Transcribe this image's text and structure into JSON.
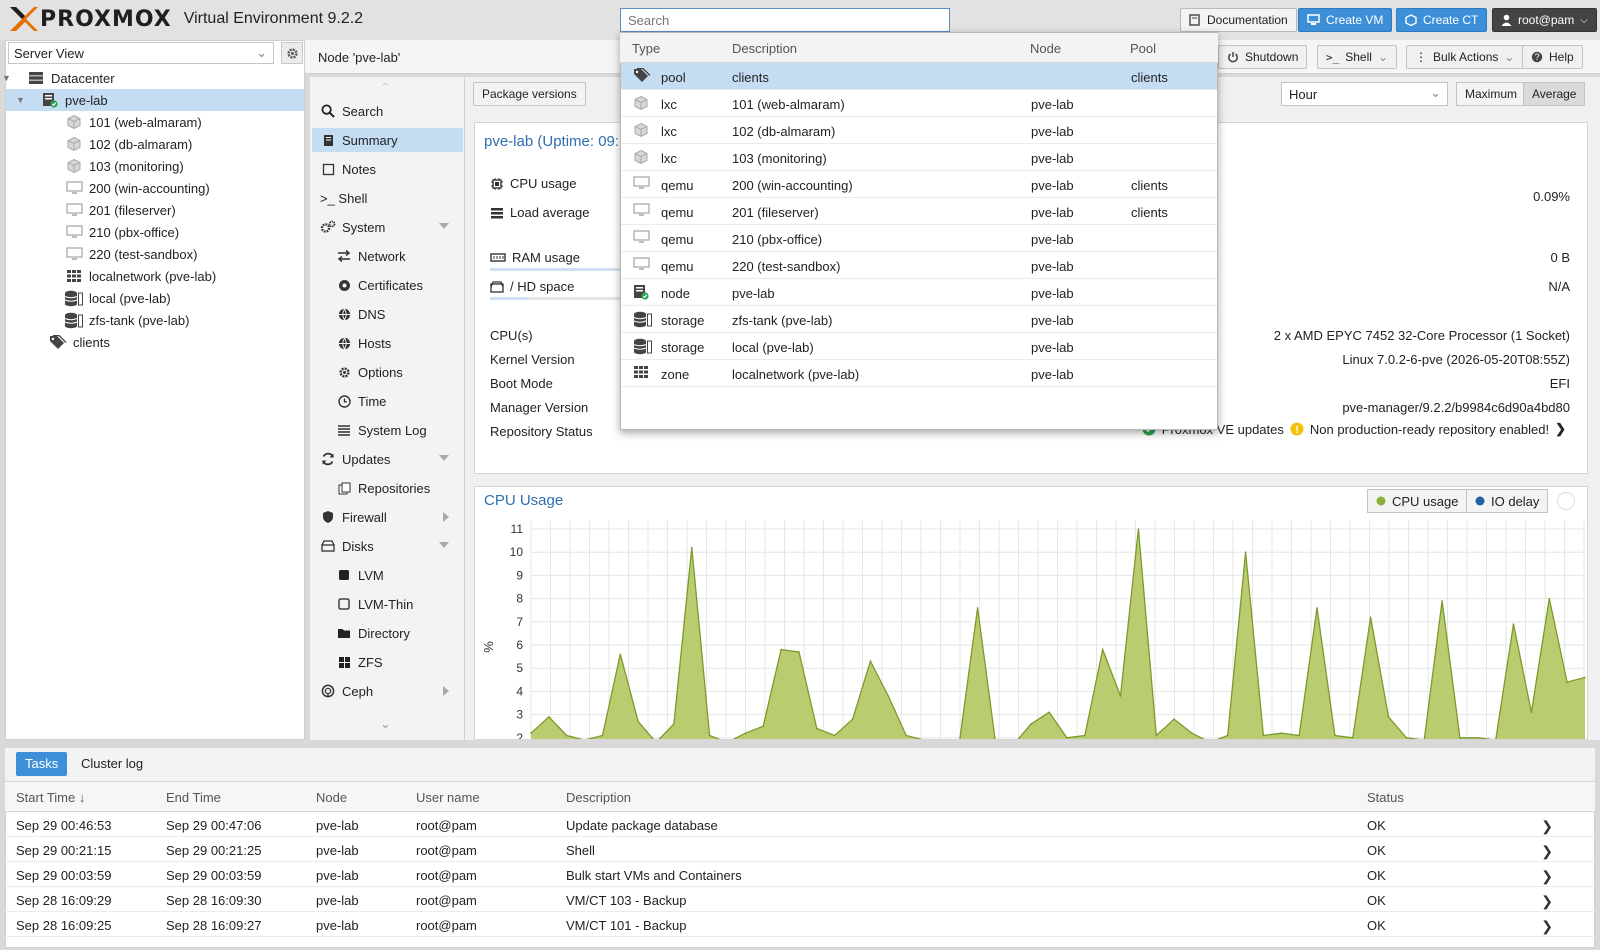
{
  "header": {
    "brand": "PROXMOX",
    "product": "Virtual Environment 9.2.2",
    "search_placeholder": "Search",
    "documentation_label": "Documentation",
    "create_vm_label": "Create VM",
    "create_ct_label": "Create CT",
    "user_label": "root@pam"
  },
  "tree": {
    "view": "Server View",
    "items": [
      {
        "label": "Datacenter",
        "icon": "datacenter-icon"
      },
      {
        "label": "pve-lab",
        "icon": "node-icon"
      },
      {
        "label": "101 (web-almaram)",
        "icon": "container-icon"
      },
      {
        "label": "102 (db-almaram)",
        "icon": "container-icon"
      },
      {
        "label": "103 (monitoring)",
        "icon": "container-icon"
      },
      {
        "label": "200 (win-accounting)",
        "icon": "vm-icon"
      },
      {
        "label": "201 (fileserver)",
        "icon": "vm-icon"
      },
      {
        "label": "210 (pbx-office)",
        "icon": "vm-icon"
      },
      {
        "label": "220 (test-sandbox)",
        "icon": "vm-icon"
      },
      {
        "label": "localnetwork (pve-lab)",
        "icon": "zone-icon"
      },
      {
        "label": "local (pve-lab)",
        "icon": "storage-icon"
      },
      {
        "label": "zfs-tank (pve-lab)",
        "icon": "storage-icon"
      },
      {
        "label": "clients",
        "icon": "pool-icon"
      }
    ]
  },
  "content": {
    "node_title": "Node 'pve-lab'",
    "shutdown_label": "Shutdown",
    "shell_label": "Shell",
    "bulk_actions_label": "Bulk Actions",
    "help_label": "Help",
    "package_versions_label": "Package versions",
    "timeframe": "Hour",
    "maximum_label": "Maximum",
    "average_label": "Average"
  },
  "submenu": {
    "items": [
      {
        "label": "Search",
        "icon": "search-icon"
      },
      {
        "label": "Summary",
        "icon": "book-icon"
      },
      {
        "label": "Notes",
        "icon": "note-icon"
      },
      {
        "label": ">_ Shell",
        "icon": ""
      },
      {
        "label": "System",
        "icon": "gears-icon"
      },
      {
        "label": "Network",
        "icon": "network-icon"
      },
      {
        "label": "Certificates",
        "icon": "certificate-icon"
      },
      {
        "label": "DNS",
        "icon": "globe-icon"
      },
      {
        "label": "Hosts",
        "icon": "globe-icon"
      },
      {
        "label": "Options",
        "icon": "gear-icon"
      },
      {
        "label": "Time",
        "icon": "clock-icon"
      },
      {
        "label": "System Log",
        "icon": "list-icon"
      },
      {
        "label": "Updates",
        "icon": "refresh-icon"
      },
      {
        "label": "Repositories",
        "icon": "files-icon"
      },
      {
        "label": "Firewall",
        "icon": "shield-icon"
      },
      {
        "label": "Disks",
        "icon": "hdd-icon"
      },
      {
        "label": "LVM",
        "icon": "square-icon"
      },
      {
        "label": "LVM-Thin",
        "icon": "square-outline-icon"
      },
      {
        "label": "Directory",
        "icon": "folder-icon"
      },
      {
        "label": "ZFS",
        "icon": "grid-icon"
      },
      {
        "label": "Ceph",
        "icon": "ceph-icon"
      }
    ]
  },
  "status": {
    "title": "pve-lab (Uptime: 09:",
    "cpu_label": "CPU usage",
    "cpu_value": "0.09%",
    "load_label": "Load average",
    "ram_label": "RAM usage",
    "ram_value": "0 B",
    "hd_label": "/ HD space",
    "hd_value": "N/A",
    "rows": [
      {
        "label": "CPU(s)",
        "value": "2 x AMD EPYC 7452 32-Core Processor (1 Socket)"
      },
      {
        "label": "Kernel Version",
        "value": "Linux 7.0.2-6-pve (2026-05-20T08:55Z)"
      },
      {
        "label": "Boot Mode",
        "value": "EFI"
      },
      {
        "label": "Manager Version",
        "value": "pve-manager/9.2.2/b9984c6d90a4bd80"
      },
      {
        "label": "Repository Status",
        "value": ""
      }
    ],
    "repo_updates": "Proxmox VE updates",
    "repo_warning": "Non production-ready repository enabled!",
    "colors": {
      "ok": "#2da44e",
      "warn": "#f4c20d"
    }
  },
  "chart_panel": {
    "title": "CPU Usage",
    "legend": [
      {
        "label": "CPU usage",
        "color": "#8bb13a"
      },
      {
        "label": "IO delay",
        "color": "#1f5fa6"
      }
    ]
  },
  "chart_data": {
    "type": "area",
    "title": "CPU Usage",
    "ylabel": "%",
    "xlabel": "",
    "ylim": [
      2,
      11
    ],
    "yticks": [
      2,
      3,
      4,
      5,
      6,
      7,
      8,
      9,
      10,
      11
    ],
    "series": [
      {
        "name": "CPU usage",
        "values": [
          2.2,
          2.9,
          2.1,
          1.9,
          2.1,
          5.6,
          2.7,
          1.8,
          2.6,
          10.2,
          2.1,
          1.8,
          2.2,
          2.5,
          5.8,
          5.7,
          2.4,
          2.1,
          2.8,
          5.3,
          3.8,
          2.1,
          1.9,
          1.8,
          1.9,
          7.6,
          1.8,
          1.7,
          2.6,
          3.1,
          2.0,
          2.1,
          5.8,
          3.8,
          11.0,
          2.1,
          2.8,
          2.2,
          1.8,
          2.1,
          10.0,
          2.1,
          2.2,
          2.1,
          7.6,
          2.1,
          2.0,
          7.2,
          2.9,
          2.0,
          1.9,
          7.9,
          2.0,
          2.0,
          1.9,
          6.9,
          3.1,
          8.0,
          4.4,
          4.6
        ]
      }
    ]
  },
  "dropdown": {
    "columns": [
      "Type",
      "Description",
      "Node",
      "Pool"
    ],
    "rows": [
      {
        "type": "pool",
        "icon": "pool-icon",
        "description": "clients",
        "node": "",
        "pool": "clients"
      },
      {
        "type": "lxc",
        "icon": "container-icon",
        "description": "101 (web-almaram)",
        "node": "pve-lab",
        "pool": ""
      },
      {
        "type": "lxc",
        "icon": "container-icon",
        "description": "102 (db-almaram)",
        "node": "pve-lab",
        "pool": ""
      },
      {
        "type": "lxc",
        "icon": "container-icon",
        "description": "103 (monitoring)",
        "node": "pve-lab",
        "pool": ""
      },
      {
        "type": "qemu",
        "icon": "vm-icon",
        "description": "200 (win-accounting)",
        "node": "pve-lab",
        "pool": "clients"
      },
      {
        "type": "qemu",
        "icon": "vm-icon",
        "description": "201 (fileserver)",
        "node": "pve-lab",
        "pool": "clients"
      },
      {
        "type": "qemu",
        "icon": "vm-icon",
        "description": "210 (pbx-office)",
        "node": "pve-lab",
        "pool": ""
      },
      {
        "type": "qemu",
        "icon": "vm-icon",
        "description": "220 (test-sandbox)",
        "node": "pve-lab",
        "pool": ""
      },
      {
        "type": "node",
        "icon": "node-icon",
        "description": "pve-lab",
        "node": "pve-lab",
        "pool": ""
      },
      {
        "type": "storage",
        "icon": "storage-icon",
        "description": "zfs-tank (pve-lab)",
        "node": "pve-lab",
        "pool": ""
      },
      {
        "type": "storage",
        "icon": "storage-icon",
        "description": "local (pve-lab)",
        "node": "pve-lab",
        "pool": ""
      },
      {
        "type": "zone",
        "icon": "zone-icon",
        "description": "localnetwork (pve-lab)",
        "node": "pve-lab",
        "pool": ""
      }
    ]
  },
  "tasks": {
    "tabs": [
      "Tasks",
      "Cluster log"
    ],
    "columns": [
      "Start Time ↓",
      "End Time",
      "Node",
      "User name",
      "Description",
      "Status"
    ],
    "rows": [
      {
        "start": "Sep 29 00:46:53",
        "end": "Sep 29 00:47:06",
        "node": "pve-lab",
        "user": "root@pam",
        "description": "Update package database",
        "status": "OK"
      },
      {
        "start": "Sep 29 00:21:15",
        "end": "Sep 29 00:21:25",
        "node": "pve-lab",
        "user": "root@pam",
        "description": "Shell",
        "status": "OK"
      },
      {
        "start": "Sep 29 00:03:59",
        "end": "Sep 29 00:03:59",
        "node": "pve-lab",
        "user": "root@pam",
        "description": "Bulk start VMs and Containers",
        "status": "OK"
      },
      {
        "start": "Sep 28 16:09:29",
        "end": "Sep 28 16:09:30",
        "node": "pve-lab",
        "user": "root@pam",
        "description": "VM/CT 103 - Backup",
        "status": "OK"
      },
      {
        "start": "Sep 28 16:09:25",
        "end": "Sep 28 16:09:27",
        "node": "pve-lab",
        "user": "root@pam",
        "description": "VM/CT 101 - Backup",
        "status": "OK"
      }
    ]
  }
}
